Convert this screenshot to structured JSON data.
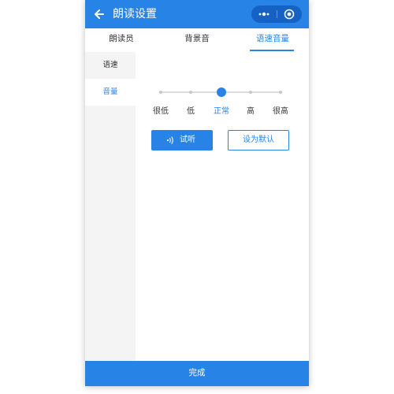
{
  "header": {
    "title": "朗读设置",
    "back_icon": "arrow-left-icon",
    "capsule": {
      "more_icon": "more-dots-icon",
      "close_icon": "target-circle-icon"
    }
  },
  "tabs": [
    {
      "label": "朗读员",
      "active": false
    },
    {
      "label": "背景音",
      "active": false
    },
    {
      "label": "语速音量",
      "active": true
    }
  ],
  "sidebar": {
    "items": [
      {
        "label": "语速",
        "selected": false
      },
      {
        "label": "音量",
        "selected": true
      }
    ]
  },
  "volume": {
    "levels": [
      "很低",
      "低",
      "正常",
      "高",
      "很高"
    ],
    "selected_index": 2,
    "selected_label": "正常"
  },
  "buttons": {
    "listen_label": "试听",
    "listen_icon": "sound-wave-icon",
    "set_default_label": "设为默认"
  },
  "footer": {
    "done_label": "完成"
  },
  "colors": {
    "accent": "#2783e6",
    "capsule": "#1562c4",
    "sidebar_bg": "#f4f4f4",
    "text": "#333333"
  }
}
